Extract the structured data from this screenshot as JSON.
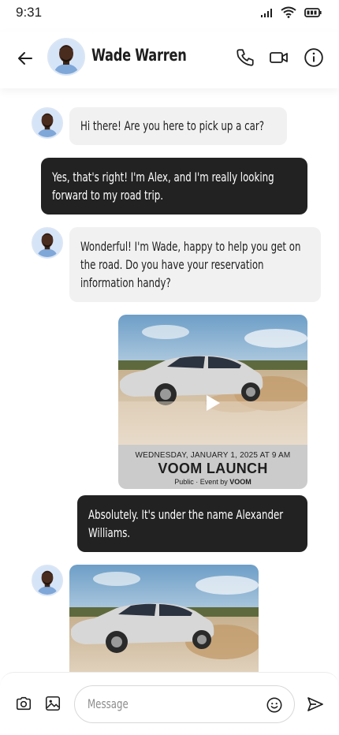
{
  "status_bar": {
    "time": "9:31"
  },
  "header": {
    "contact_name": "Wade Warren"
  },
  "messages": [
    {
      "from": "wade",
      "lines": [
        "Hi there! Are you here to pick up a car?"
      ]
    },
    {
      "from": "me",
      "lines": [
        "Yes, that's right! I'm Alex, and I'm really looking",
        "forward to my road trip."
      ]
    },
    {
      "from": "wade",
      "lines": [
        "Wonderful! I'm Wade, happy to help you get on",
        "the road.  Do you have your reservation",
        "information handy?"
      ]
    },
    {
      "from": "me",
      "type": "event-card",
      "event": {
        "date": "WEDNESDAY, JANUARY 1, 2025 AT 9 AM",
        "title": "VOOM LAUNCH",
        "meta_prefix": "Public · Event by ",
        "meta_host": "VOOM"
      }
    },
    {
      "from": "me",
      "lines": [
        "Absolutely. It's under the name Alexander",
        "Williams."
      ]
    },
    {
      "from": "wade",
      "type": "image"
    }
  ],
  "composer": {
    "placeholder": "Message"
  },
  "colors": {
    "incoming_bubble": "#f1f1f1",
    "outgoing_bubble": "#222222",
    "avatar_ring": "#dbe6f5"
  }
}
